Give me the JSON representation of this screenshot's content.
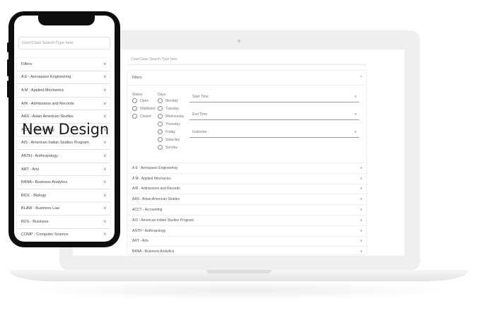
{
  "overlay": {
    "title": "New Design"
  },
  "colors": {
    "phone_frame": "#0d0d0d",
    "laptop_frame": "#efefef",
    "text": "#444444"
  },
  "desktop": {
    "search_placeholder": "Cour/Class Search-Type here",
    "filters_label": "Filters",
    "filters_chevron": "^",
    "status_label": "Status",
    "statuses": [
      "Open",
      "Waitlisted",
      "Closed"
    ],
    "days_label": "Days",
    "days": [
      "Monday",
      "Tuesday",
      "Wednesday",
      "Thursday",
      "Friday",
      "Saturday",
      "Sunday"
    ],
    "selects": [
      "Start Time",
      "End Time",
      "Instructor"
    ],
    "chevron": "v",
    "courses": [
      "A E - Aerospace Engineering",
      "A M - Applied Mechanics",
      "A/R - Admissions and Records",
      "AAS - Asian American Studies",
      "ACCT - Accounting",
      "AIS - American Indian Studies Program",
      "ANTH - Anthropology",
      "ART - Arts",
      "BANA - Business Analytics"
    ]
  },
  "mobile": {
    "search_placeholder": "Cour/Class Search-Type here",
    "chevron": "v",
    "items": [
      "Filters",
      "A E - Aerospace Engineering",
      "A M - Applied Mechanics",
      "A/R - Admissions and Records",
      "AAS - Asian American Studies",
      "ACCT - Accounting",
      "AIS - American Indian Studies Program",
      "ANTH - Anthropology",
      "ART - Arts",
      "BANA - Business Analytics",
      "BIOL - Biology",
      "BLAW - Business Law",
      "BUS - Business",
      "COMP - Computer Science"
    ]
  }
}
